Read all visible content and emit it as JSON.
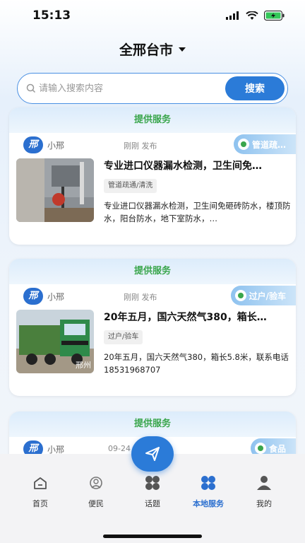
{
  "status": {
    "time": "15:13"
  },
  "header": {
    "city": "全邢台市"
  },
  "search": {
    "placeholder": "请输入搜索内容",
    "button_label": "搜索"
  },
  "posts": [
    {
      "banner": "提供服务",
      "avatar_text": "邢",
      "poster": "小邢",
      "time": "刚刚 发布",
      "category": "管道疏…",
      "title": "专业进口仪器漏水检测，卫生间免…",
      "chip": "管道疏通/清洗",
      "desc": "专业进口仪器漏水检测，卫生间免砸砖防水，楼顶防水，阳台防水，地下室防水，…"
    },
    {
      "banner": "提供服务",
      "avatar_text": "邢",
      "poster": "小邢",
      "time": "刚刚 发布",
      "category": "过户/验车",
      "title": "20年五月，国六天然气380，箱长…",
      "chip": "过户/验车",
      "desc": "20年五月，国六天然气380，箱长5.8米，联系电话18531968707",
      "thumb_caption": "邢州"
    },
    {
      "banner": "提供服务",
      "avatar_text": "邢",
      "poster": "小邢",
      "time": "09-24",
      "category": "食品"
    }
  ],
  "tabs": [
    {
      "label": "首页",
      "icon": "home-icon"
    },
    {
      "label": "便民",
      "icon": "convenience-icon"
    },
    {
      "label": "话题",
      "icon": "topics-icon"
    },
    {
      "label": "本地服务",
      "icon": "local-services-icon",
      "active": true
    },
    {
      "label": "我的",
      "icon": "profile-icon"
    }
  ],
  "colors": {
    "accent": "#2b7bd8",
    "banner_text": "#3aa64c"
  }
}
